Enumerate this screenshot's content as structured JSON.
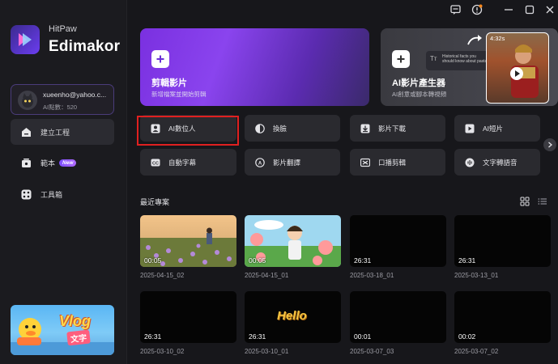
{
  "brand": {
    "small": "HitPaw",
    "big": "Edimakor"
  },
  "account": {
    "email": "xueenho@yahoo.c...",
    "points": "AI點數：520"
  },
  "nav": [
    {
      "label": "建立工程",
      "icon": "home-icon",
      "active": true
    },
    {
      "label": "範本",
      "icon": "template-icon",
      "badge": "New"
    },
    {
      "label": "工具箱",
      "icon": "toolbox-icon"
    }
  ],
  "promo": {
    "title": "Vlog",
    "subtitle": "文字"
  },
  "hero": [
    {
      "title": "剪輯影片",
      "subtitle": "新增檔案並開始剪輯"
    },
    {
      "title": "AI影片產生器",
      "subtitle": "AI創意或腳本轉視頻",
      "preview_duration": "4:32s",
      "preview_caption": "Historical facts you should know about pasta"
    }
  ],
  "features": [
    {
      "label": "AI數位人",
      "icon": "avatar-icon"
    },
    {
      "label": "換臉",
      "icon": "face-swap-icon"
    },
    {
      "label": "影片下載",
      "icon": "download-icon"
    },
    {
      "label": "AI短片",
      "icon": "ai-clip-icon"
    },
    {
      "label": "自動字幕",
      "icon": "cc-icon"
    },
    {
      "label": "影片翻譯",
      "icon": "translate-icon"
    },
    {
      "label": "口播剪輯",
      "icon": "voice-edit-icon"
    },
    {
      "label": "文字轉語音",
      "icon": "tts-icon"
    }
  ],
  "recent": {
    "title": "最近專案",
    "projects": [
      {
        "name": "2025-04-15_02",
        "duration": "00:05",
        "thumb": "flower-field"
      },
      {
        "name": "2025-04-15_01",
        "duration": "00:05",
        "thumb": "anime-garden"
      },
      {
        "name": "2025-03-18_01",
        "duration": "26:31",
        "thumb": "black"
      },
      {
        "name": "2025-03-13_01",
        "duration": "26:31",
        "thumb": "black"
      },
      {
        "name": "2025-03-10_02",
        "duration": "26:31",
        "thumb": "black"
      },
      {
        "name": "2025-03-10_01",
        "duration": "26:31",
        "thumb": "hello",
        "overlay_text": "Hello"
      },
      {
        "name": "2025-03-07_03",
        "duration": "00:01",
        "thumb": "black"
      },
      {
        "name": "2025-03-07_02",
        "duration": "00:02",
        "thumb": "black"
      }
    ]
  },
  "colors": {
    "accent": "#7b4dff",
    "highlight": "#e02020",
    "bg": "#17171b",
    "card": "#2a2a2f"
  }
}
